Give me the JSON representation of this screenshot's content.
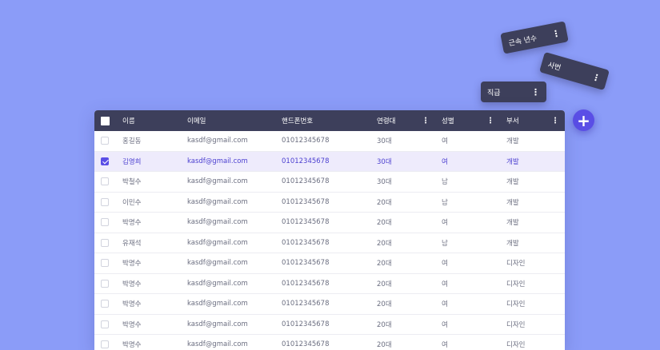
{
  "floating_chips": [
    {
      "label": "근속 년수"
    },
    {
      "label": "사번"
    },
    {
      "label": "직급"
    }
  ],
  "add_button": {
    "label": "+"
  },
  "kebab": "⋮",
  "table": {
    "headers": {
      "name": "이름",
      "email": "이메일",
      "phone": "핸드폰번호",
      "age": "연령대",
      "sex": "성별",
      "dept": "부서"
    },
    "rows": [
      {
        "name": "홍길동",
        "email": "kasdf@gmail.com",
        "phone": "01012345678",
        "age": "30대",
        "sex": "여",
        "dept": "개발",
        "checked": false
      },
      {
        "name": "김영희",
        "email": "kasdf@gmail.com",
        "phone": "01012345678",
        "age": "30대",
        "sex": "여",
        "dept": "개발",
        "checked": true
      },
      {
        "name": "박철수",
        "email": "kasdf@gmail.com",
        "phone": "01012345678",
        "age": "30대",
        "sex": "남",
        "dept": "개발",
        "checked": false
      },
      {
        "name": "이민수",
        "email": "kasdf@gmail.com",
        "phone": "01012345678",
        "age": "20대",
        "sex": "남",
        "dept": "개발",
        "checked": false
      },
      {
        "name": "박명수",
        "email": "kasdf@gmail.com",
        "phone": "01012345678",
        "age": "20대",
        "sex": "여",
        "dept": "개발",
        "checked": false
      },
      {
        "name": "유재석",
        "email": "kasdf@gmail.com",
        "phone": "01012345678",
        "age": "20대",
        "sex": "남",
        "dept": "개발",
        "checked": false
      },
      {
        "name": "박명수",
        "email": "kasdf@gmail.com",
        "phone": "01012345678",
        "age": "20대",
        "sex": "여",
        "dept": "디자인",
        "checked": false
      },
      {
        "name": "박명수",
        "email": "kasdf@gmail.com",
        "phone": "01012345678",
        "age": "20대",
        "sex": "여",
        "dept": "디자인",
        "checked": false
      },
      {
        "name": "박명수",
        "email": "kasdf@gmail.com",
        "phone": "01012345678",
        "age": "20대",
        "sex": "여",
        "dept": "디자인",
        "checked": false
      },
      {
        "name": "박명수",
        "email": "kasdf@gmail.com",
        "phone": "01012345678",
        "age": "20대",
        "sex": "여",
        "dept": "디자인",
        "checked": false
      },
      {
        "name": "박명수",
        "email": "kasdf@gmail.com",
        "phone": "01012345678",
        "age": "20대",
        "sex": "여",
        "dept": "디자인",
        "checked": false
      }
    ]
  },
  "colors": {
    "background": "#8b9cf8",
    "header": "#3d3f5b",
    "accent": "#5a4ee6",
    "selected_row": "#eeebfc"
  }
}
